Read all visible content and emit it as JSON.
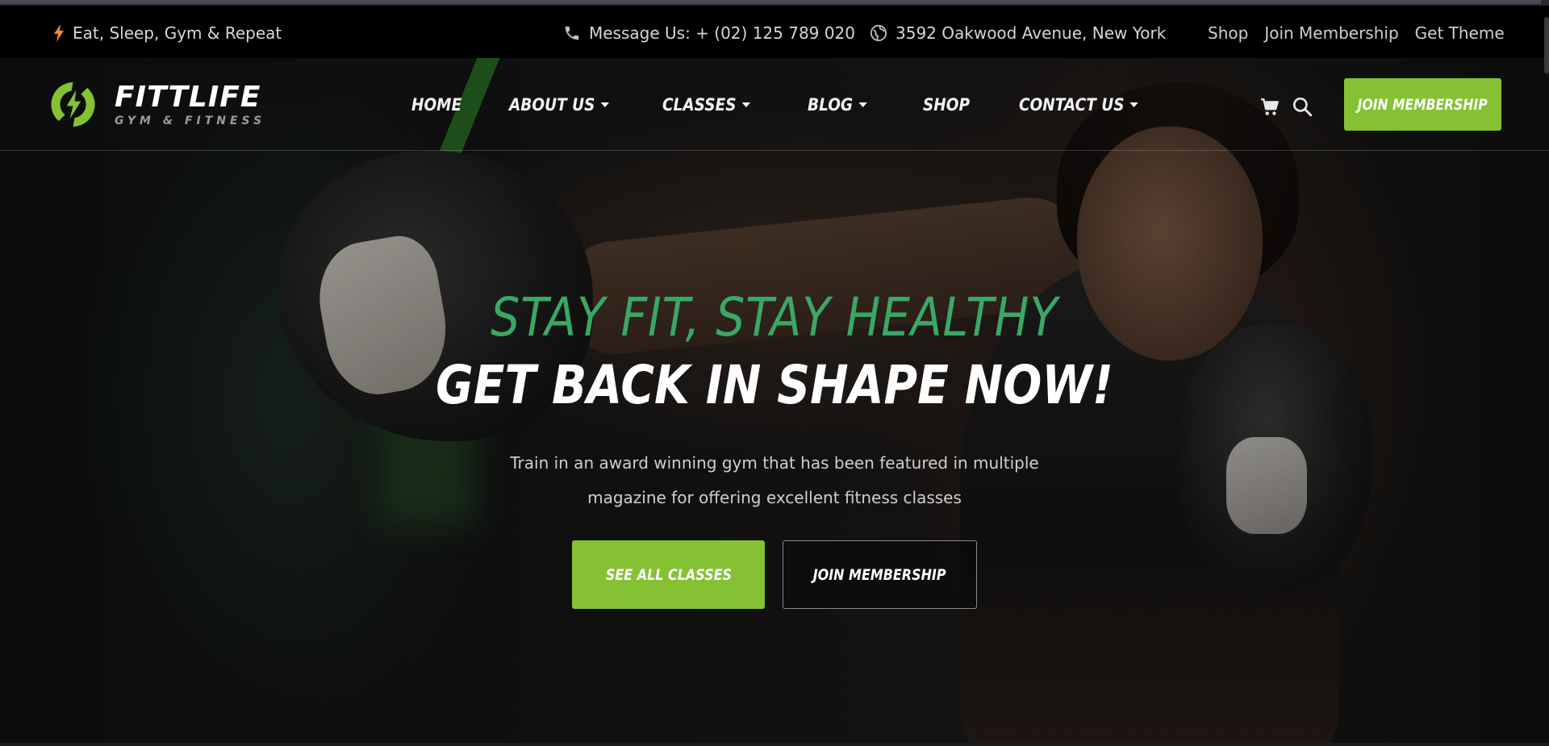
{
  "topbar": {
    "tagline": "Eat, Sleep, Gym & Repeat",
    "phone": "Message Us: + (02) 125 789 020",
    "address": "3592 Oakwood Avenue, New York",
    "links": [
      "Shop",
      "Join Membership",
      "Get Theme"
    ]
  },
  "brand": {
    "name": "FITTLIFE",
    "subtitle": "GYM & FITNESS",
    "accent_color": "#84c234",
    "kicker_color": "#3aa865"
  },
  "nav": {
    "items": [
      {
        "label": "HOME",
        "has_dropdown": false
      },
      {
        "label": "ABOUT US",
        "has_dropdown": true
      },
      {
        "label": "CLASSES",
        "has_dropdown": true
      },
      {
        "label": "BLOG",
        "has_dropdown": true
      },
      {
        "label": "SHOP",
        "has_dropdown": false
      },
      {
        "label": "CONTACT US",
        "has_dropdown": true
      }
    ],
    "cart_icon": "cart-icon",
    "search_icon": "search-icon",
    "cta_label": "JOIN MEMBERSHIP"
  },
  "hero": {
    "kicker": "STAY FIT, STAY HEALTHY",
    "headline": "GET BACK IN SHAPE NOW!",
    "description_line1": "Train in an award winning gym that has been featured in multiple",
    "description_line2": "magazine for offering excellent fitness classes",
    "primary_button": "SEE ALL CLASSES",
    "secondary_button": "JOIN MEMBERSHIP"
  }
}
